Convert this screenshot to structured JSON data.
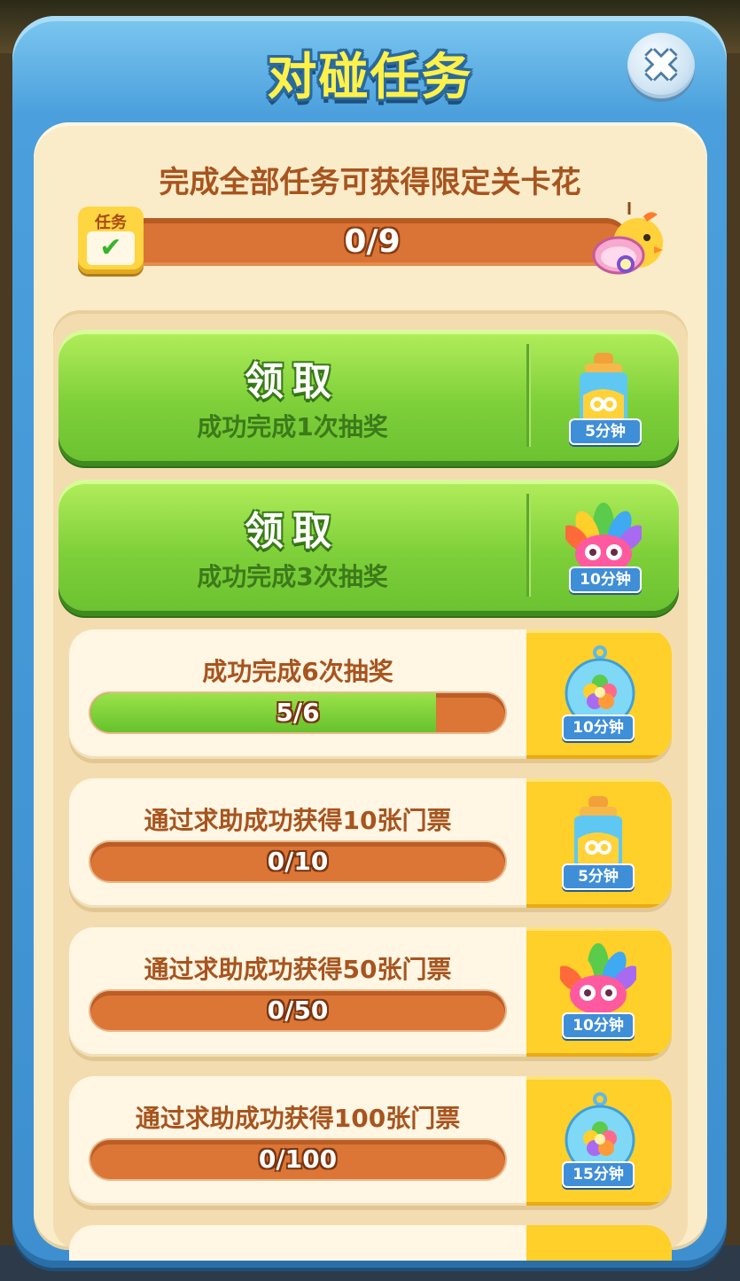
{
  "title": "对碰任务",
  "close_label": "✖",
  "header": {
    "goal_text": "完成全部任务可获得限定关卡花",
    "badge_label": "任务",
    "badge_check": "✔",
    "progress_text": "0/9",
    "progress_fraction": 0.0
  },
  "claim_tasks": [
    {
      "button_label": "领取",
      "description": "成功完成1次抽奖",
      "reward_icon": "bottle-icon",
      "duration": "5分钟"
    },
    {
      "button_label": "领取",
      "description": "成功完成3次抽奖",
      "reward_icon": "rainbow-owl-icon",
      "duration": "10分钟"
    }
  ],
  "tasks": [
    {
      "title": "成功完成6次抽奖",
      "progress_text": "5/6",
      "progress_fraction": 0.8333,
      "reward_icon": "flower-bubble-icon",
      "duration": "10分钟"
    },
    {
      "title": "通过求助成功获得10张门票",
      "progress_text": "0/10",
      "progress_fraction": 0.0,
      "reward_icon": "bottle-icon",
      "duration": "5分钟"
    },
    {
      "title": "通过求助成功获得50张门票",
      "progress_text": "0/50",
      "progress_fraction": 0.0,
      "reward_icon": "rainbow-owl-icon",
      "duration": "10分钟"
    },
    {
      "title": "通过求助成功获得100张门票",
      "progress_text": "0/100",
      "progress_fraction": 0.0,
      "reward_icon": "flower-bubble-icon",
      "duration": "15分钟"
    }
  ],
  "colors": {
    "frame_blue": "#4a9fdc",
    "panel_cream": "#fbecc9",
    "title_yellow": "#fff14a",
    "text_brown": "#a8541e",
    "claim_green": "#7fd03a",
    "bar_orange": "#db7636",
    "reward_yellow": "#ffcf2a",
    "duration_blue": "#3f8ed8"
  }
}
